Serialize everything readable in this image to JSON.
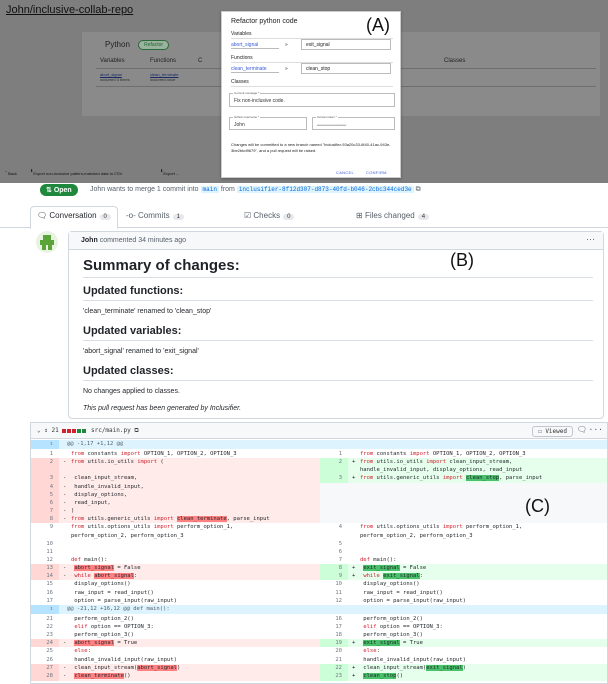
{
  "panel_labels": {
    "a": "(A)",
    "b": "(B)",
    "c": "(C)"
  },
  "panel_a": {
    "repo_title": "John/inclusive-collab-repo",
    "language": "Python",
    "language_badge": "Refactor",
    "table_headers": [
      "Variables",
      "Functions",
      "C",
      "Classes"
    ],
    "bg_var_cell": [
      "abort_signal",
      "occurred 3 times"
    ],
    "bg_func_cell": [
      "clean_terminate",
      "occurred once"
    ],
    "bottom_back": "Back",
    "bottom_export_csv": "Export non-inclusive pattern-matched data to CSV",
    "bottom_export_cut": "Export ...",
    "dialog": {
      "title": "Refactor python code",
      "variables_header": "Variables",
      "var_old": "abort_signal",
      "var_arrow": "»",
      "var_new": "exit_signal",
      "functions_header": "Functions",
      "func_old": "clean_terminate",
      "func_arrow": "»",
      "func_new": "clean_stop",
      "classes_header": "Classes",
      "commit_label": "Commit message *",
      "commit_value": "Fix non-inclusive code.",
      "username_label": "Github username *",
      "username_value": "John",
      "token_label": "Access token *",
      "token_value": "••••••••••••••••••••••••••••",
      "note": "Changes will be committed to a new branch named \"inclusifier-93a20c33-6f40-41ac-943e-3be2bbd9679\", and a pull request will be raised.",
      "cancel": "CANCEL",
      "confirm": "CONFIRM"
    }
  },
  "panel_b": {
    "badge": "Open",
    "pr_prefix": "John wants to merge 1 commit into",
    "base_branch": "main",
    "from_word": "from",
    "head_branch": "inclusifier-8f12d307-d873-40fd-b046-2cbc344ced3e",
    "tabs": [
      {
        "label": "Conversation",
        "count": "0"
      },
      {
        "label": "Commits",
        "count": "1"
      },
      {
        "label": "Checks",
        "count": "0"
      },
      {
        "label": "Files changed",
        "count": "4"
      }
    ],
    "comment_author": "John",
    "comment_meta": "commented 34 minutes ago",
    "dots": "···",
    "summary_title": "Summary of changes:",
    "functions_title": "Updated functions:",
    "functions_text": "'clean_terminate' renamed to 'clean_stop'",
    "variables_title": "Updated variables:",
    "variables_text": "'abort_signal' renamed to 'exit_signal'",
    "classes_title": "Updated classes:",
    "classes_text": "No changes applied to classes.",
    "footer_text": "This pull request has been generated by Inclusifier."
  },
  "panel_c": {
    "file_change_count": "21",
    "file_path": "src/main.py",
    "viewed_label": "Viewed",
    "menu": "···",
    "rows": [
      {
        "t": "hunk",
        "text": "@@ -1,17 +1,12 @@"
      },
      {
        "l": "1",
        "lc": " ",
        "lt": "from constants import OPTION_1, OPTION_2, OPTION_3",
        "r": "1",
        "rc": " ",
        "rt": "from constants import OPTION_1, OPTION_2, OPTION_3"
      },
      {
        "l": "2",
        "lc": "-",
        "lt": "from utils.io_utils import (",
        "r": "2",
        "rc": "+",
        "rt": "from utils.io_utils import clean_input_stream,"
      },
      {
        "l": "",
        "lc": "",
        "lt": "",
        "r": "",
        "rc": "",
        "rt": "handle_invalid_input, display_options, read_input",
        "lk": "del",
        "rk": "add"
      },
      {
        "l": "3",
        "lc": "-",
        "lt": "    clean_input_stream,",
        "r": "3",
        "rc": "+",
        "rt": "from utils.generic_utils import clean_stop, parse_input"
      },
      {
        "l": "4",
        "lc": "-",
        "lt": "    handle_invalid_input,",
        "r": "",
        "rc": "",
        "rt": "",
        "rk": "empty"
      },
      {
        "l": "5",
        "lc": "-",
        "lt": "    display_options,",
        "r": "",
        "rc": "",
        "rt": "",
        "rk": "empty"
      },
      {
        "l": "6",
        "lc": "-",
        "lt": "    read_input,",
        "r": "",
        "rc": "",
        "rt": "",
        "rk": "empty"
      },
      {
        "l": "7",
        "lc": "-",
        "lt": ")",
        "r": "",
        "rc": "",
        "rt": "",
        "rk": "empty"
      },
      {
        "l": "8",
        "lc": "-",
        "lt": "from utils.generic_utils import clean_terminate, parse_input",
        "r": "",
        "rc": "",
        "rt": "",
        "rk": "empty"
      },
      {
        "l": "9",
        "lc": " ",
        "lt": "from utils.options_utils import perform_option_1,",
        "r": "4",
        "rc": " ",
        "rt": "from utils.options_utils import perform_option_1,"
      },
      {
        "l": "",
        "lc": "",
        "lt": "perform_option_2, perform_option_3",
        "r": "",
        "rc": "",
        "rt": "perform_option_2, perform_option_3"
      },
      {
        "l": "10",
        "lc": " ",
        "lt": "",
        "r": "5",
        "rc": " ",
        "rt": ""
      },
      {
        "l": "11",
        "lc": " ",
        "lt": "",
        "r": "6",
        "rc": " ",
        "rt": ""
      },
      {
        "l": "12",
        "lc": " ",
        "lt": "def main():",
        "r": "7",
        "rc": " ",
        "rt": "def main():"
      },
      {
        "l": "13",
        "lc": "-",
        "lt": "    abort_signal = False",
        "r": "8",
        "rc": "+",
        "rt": "    exit_signal = False"
      },
      {
        "l": "14",
        "lc": "-",
        "lt": "    while abort_signal:",
        "r": "9",
        "rc": "+",
        "rt": "    while exit_signal:"
      },
      {
        "l": "15",
        "lc": " ",
        "lt": "        display_options()",
        "r": "10",
        "rc": " ",
        "rt": "        display_options()"
      },
      {
        "l": "16",
        "lc": " ",
        "lt": "        raw_input = read_input()",
        "r": "11",
        "rc": " ",
        "rt": "        raw_input = read_input()"
      },
      {
        "l": "17",
        "lc": " ",
        "lt": "        option = parse_input(raw_input)",
        "r": "12",
        "rc": " ",
        "rt": "        option = parse_input(raw_input)"
      },
      {
        "t": "hunk",
        "text": "@@ -21,12 +16,12 @@ def main():"
      },
      {
        "l": "21",
        "lc": " ",
        "lt": "            perform_option_2()",
        "r": "16",
        "rc": " ",
        "rt": "            perform_option_2()"
      },
      {
        "l": "22",
        "lc": " ",
        "lt": "        elif option == OPTION_3:",
        "r": "17",
        "rc": " ",
        "rt": "        elif option == OPTION_3:"
      },
      {
        "l": "23",
        "lc": " ",
        "lt": "            perform_option_3()",
        "r": "18",
        "rc": " ",
        "rt": "            perform_option_3()"
      },
      {
        "l": "24",
        "lc": "-",
        "lt": "            abort_signal = True",
        "r": "19",
        "rc": "+",
        "rt": "            exit_signal = True"
      },
      {
        "l": "25",
        "lc": " ",
        "lt": "        else:",
        "r": "20",
        "rc": " ",
        "rt": "        else:"
      },
      {
        "l": "26",
        "lc": " ",
        "lt": "            handle_invalid_input(raw_input)",
        "r": "21",
        "rc": " ",
        "rt": "            handle_invalid_input(raw_input)"
      },
      {
        "l": "27",
        "lc": "-",
        "lt": "        clean_input_stream(abort_signal)",
        "r": "22",
        "rc": "+",
        "rt": "        clean_input_stream(exit_signal)"
      },
      {
        "l": "28",
        "lc": "-",
        "lt": "    clean_terminate()",
        "r": "23",
        "rc": "+",
        "rt": "    clean_stop()"
      }
    ],
    "highlights": [
      "abort_signal",
      "exit_signal",
      "clean_terminate",
      "clean_stop"
    ],
    "keywords": [
      "from",
      "import",
      "def",
      "while",
      "elif",
      "else"
    ]
  },
  "colors": {
    "github_green": "#1f883d",
    "del_bg": "#ffebe9",
    "del_num_bg": "#ffd7d5",
    "add_bg": "#e6ffec",
    "add_num_bg": "#ccffd8",
    "hunk_bg": "#ddf4ff",
    "link_blue": "#3b5bd9",
    "overlay_grey": "#7e7e7e"
  }
}
